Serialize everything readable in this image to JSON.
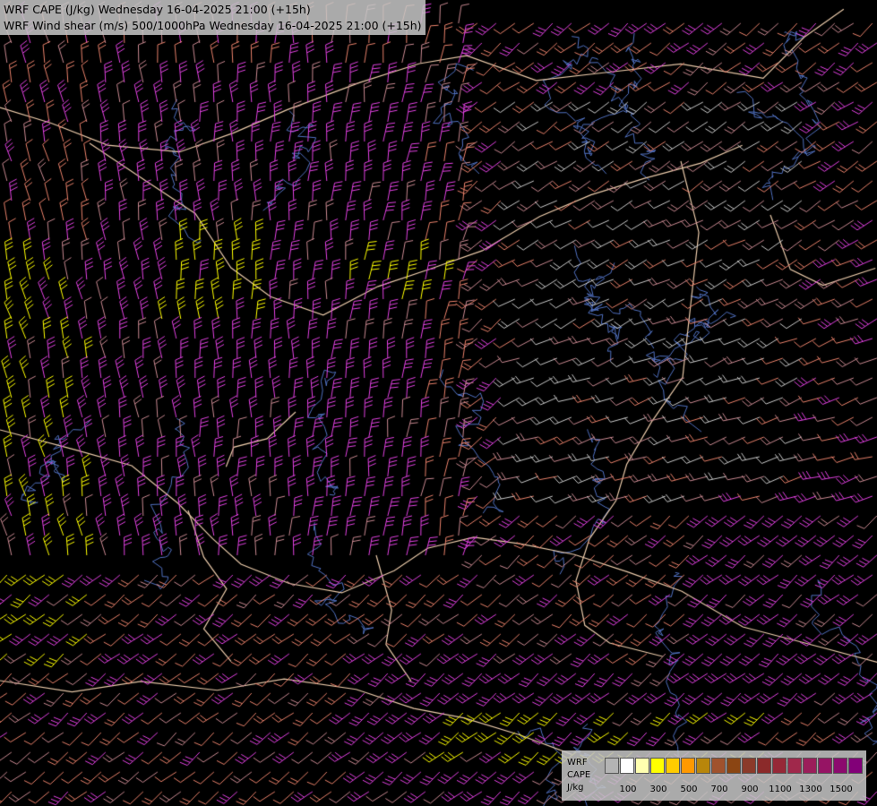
{
  "title": {
    "line1": "WRF CAPE (J/kg) Wednesday 16-04-2025 21:00 (+15h)",
    "line2": "WRF Wind shear (m/s) 500/1000hPa Wednesday 16-04-2025 21:00 (+15h)"
  },
  "legend": {
    "label1": "WRF",
    "label2": "CAPE",
    "label3": "J/kg",
    "colors": [
      "#b4b4b4",
      "#ffffff",
      "#ffffb0",
      "#ffff00",
      "#ffcc00",
      "#ff9900",
      "#b8860b",
      "#a0522d",
      "#8b4513",
      "#8b3a2a",
      "#8b2a2a",
      "#962837",
      "#a0284b",
      "#9b1e5a",
      "#961464",
      "#8c0a6e",
      "#820078"
    ],
    "ticks": [
      "100",
      "300",
      "500",
      "700",
      "900",
      "1100",
      "1300",
      "1500"
    ]
  },
  "map_style": {
    "background": "#000000",
    "border_color": "#e8c8a8",
    "river_color": "#5070c0",
    "barb_colors": {
      "low": "#c8c8c8",
      "mid": "#e8806a",
      "high": "#e040e0",
      "yellow": "#ffff00",
      "dark": "#c88890"
    }
  }
}
